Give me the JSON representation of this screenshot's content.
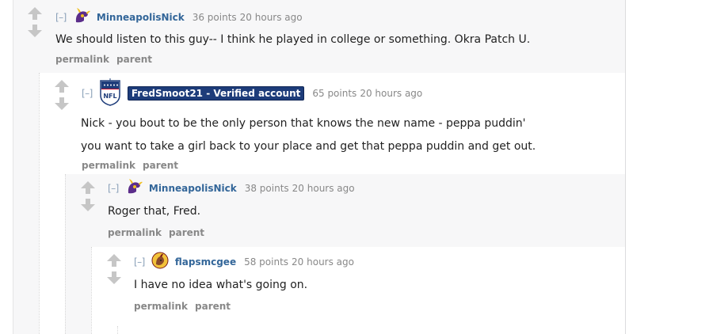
{
  "comments": [
    {
      "author": "MinneapolisNick",
      "expand": "[–]",
      "score": "36 points",
      "age": "20 hours ago",
      "lines": [
        "We should listen to this guy-- I think he played in college or something. Okra Patch U."
      ],
      "permalink": "permalink",
      "parent": "parent",
      "flair_icon": "vikings-icon"
    },
    {
      "author": "FredSmoot21 - Verified account",
      "expand": "[–]",
      "score": "65 points",
      "age": "20 hours ago",
      "lines": [
        "Nick - you bout to be the only person that knows the new name - peppa puddin'",
        "you want to take a girl back to your place and get that peppa puddin and get out."
      ],
      "permalink": "permalink",
      "parent": "parent",
      "flair_icon": "nfl-shield-icon",
      "flair_text": "NFL"
    },
    {
      "author": "MinneapolisNick",
      "expand": "[–]",
      "score": "38 points",
      "age": "20 hours ago",
      "lines": [
        "Roger that, Fred."
      ],
      "permalink": "permalink",
      "parent": "parent",
      "flair_icon": "vikings-icon"
    },
    {
      "author": "flapsmcgee",
      "expand": "[–]",
      "score": "58 points",
      "age": "20 hours ago",
      "lines": [
        "I have no idea what's going on."
      ],
      "permalink": "permalink",
      "parent": "parent",
      "flair_icon": "redskins-icon"
    }
  ],
  "colors": {
    "author_link": "#336699",
    "verified_tag_bg": "#1d3c7a",
    "arrow": "#c6c6c6",
    "meta_text": "#888888"
  }
}
